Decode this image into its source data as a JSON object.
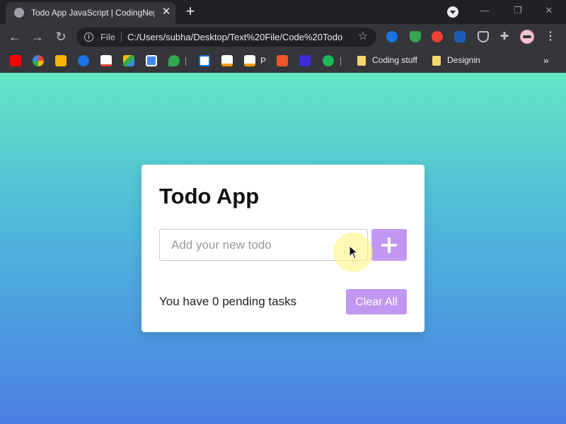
{
  "browser": {
    "tab": {
      "title": "Todo App JavaScript | CodingNepal",
      "close": "✕"
    },
    "new_tab": "+",
    "window_controls": {
      "minimize": "—",
      "restore": "❐",
      "close": "✕"
    },
    "toolbar": {
      "back": "←",
      "forward": "→",
      "reload": "↻",
      "scheme": "File",
      "url": "C:/Users/subha/Desktop/Text%20File/Code%20Todo",
      "star": "☆",
      "extensions": "✚",
      "menu": "⋮"
    },
    "bookmarks": {
      "letter_p": "P",
      "folders": [
        "Coding stuff",
        "Designin"
      ],
      "more": "»"
    }
  },
  "app": {
    "title": "Todo App",
    "input_placeholder": "Add your new todo",
    "input_value": "",
    "pending_prefix": "You have ",
    "pending_count": "0",
    "pending_suffix": " pending tasks",
    "clear_label": "Clear All"
  },
  "colors": {
    "accent": "#c197f2",
    "gradient_top": "#62e6c4",
    "gradient_bottom": "#4b7fe4"
  }
}
